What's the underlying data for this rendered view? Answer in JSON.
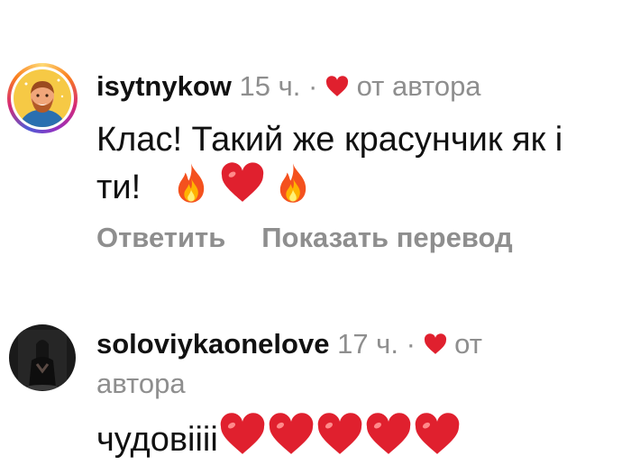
{
  "comments": [
    {
      "username": "isytnykow",
      "time": "15 ч.",
      "separator": "·",
      "liked_by_author": "от автора",
      "text_line1": "Клас! Такий же красунчик як і",
      "text_line2": "ти!",
      "emojis": [
        "fire",
        "heart",
        "fire"
      ],
      "actions": {
        "reply": "Ответить",
        "translate": "Показать перевод"
      }
    },
    {
      "username": "soloviykaonelove",
      "time": "17 ч.",
      "separator": "·",
      "liked_by_author_part1": "от",
      "liked_by_author_part2": "автора",
      "text": "чудовіііі",
      "emojis": [
        "heart",
        "heart",
        "heart",
        "heart",
        "heart"
      ]
    }
  ],
  "colors": {
    "heart": "#e0202e",
    "muted": "#8e8e8e",
    "text": "#111111"
  }
}
